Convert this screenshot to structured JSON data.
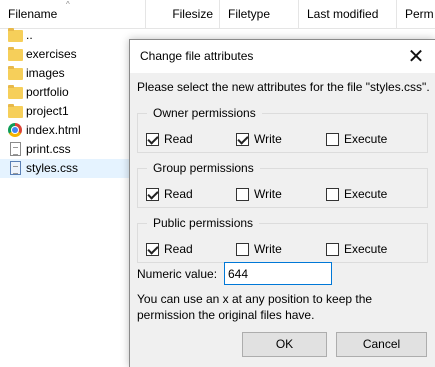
{
  "filelist": {
    "columns": [
      "Filename",
      "Filesize",
      "Filetype",
      "Last modified",
      "Perm"
    ],
    "rows": [
      {
        "name": "..",
        "icon": "folder-icon"
      },
      {
        "name": "exercises",
        "icon": "folder-icon"
      },
      {
        "name": "images",
        "icon": "folder-icon"
      },
      {
        "name": "portfolio",
        "icon": "folder-icon"
      },
      {
        "name": "project1",
        "icon": "folder-icon"
      },
      {
        "name": "index.html",
        "icon": "chrome-icon"
      },
      {
        "name": "print.css",
        "icon": "css-file-icon"
      },
      {
        "name": "styles.css",
        "icon": "css-file-icon",
        "selected": true
      }
    ]
  },
  "dialog": {
    "title": "Change file attributes",
    "close_glyph": "✕",
    "prompt": "Please select the new attributes for the file \"styles.css\".",
    "groups": [
      {
        "label": "Owner permissions",
        "read": "Read",
        "write": "Write",
        "execute": "Execute",
        "read_checked": true,
        "write_checked": true,
        "execute_checked": false
      },
      {
        "label": "Group permissions",
        "read": "Read",
        "write": "Write",
        "execute": "Execute",
        "read_checked": true,
        "write_checked": false,
        "execute_checked": false
      },
      {
        "label": "Public permissions",
        "read": "Read",
        "write": "Write",
        "execute": "Execute",
        "read_checked": true,
        "write_checked": false,
        "execute_checked": false
      }
    ],
    "numeric_label": "Numeric value:",
    "numeric_value": "644",
    "hint": "You can use an x at any position to keep the permission the original files have.",
    "ok_label": "OK",
    "cancel_label": "Cancel"
  }
}
